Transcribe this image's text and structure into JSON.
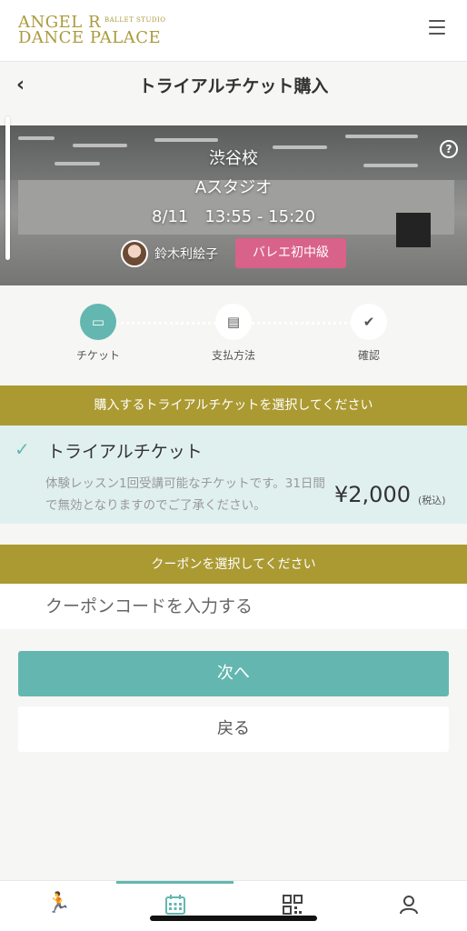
{
  "header": {
    "logo_line1": "ANGEL R",
    "logo_sub": "BALLET STUDIO",
    "logo_line2": "DANCE PALACE"
  },
  "titlebar": {
    "title": "トライアルチケット購入"
  },
  "hero": {
    "school": "渋谷校",
    "studio": "Aスタジオ",
    "time": "8/11　13:55 - 15:20",
    "teacher": "鈴木利絵子",
    "level": "バレエ初中級"
  },
  "steps": [
    {
      "label": "チケット",
      "icon": "ticket-icon",
      "active": true
    },
    {
      "label": "支払方法",
      "icon": "card-icon",
      "active": false
    },
    {
      "label": "確認",
      "icon": "check-icon",
      "active": false
    }
  ],
  "ticket_section": {
    "heading": "購入するトライアルチケットを選択してください"
  },
  "ticket": {
    "name": "トライアルチケット",
    "description": "体験レッスン1回受講可能なチケットです。31日間で無効となりますのでご了承ください。",
    "price": "¥2,000",
    "tax": "(税込)"
  },
  "coupon_section": {
    "heading": "クーポンを選択してください"
  },
  "coupon": {
    "placeholder": "クーポンコードを入力する"
  },
  "buttons": {
    "next": "次へ",
    "back": "戻る"
  },
  "tabs": [
    {
      "icon": "running-icon",
      "active": false
    },
    {
      "icon": "calendar-icon",
      "active": true
    },
    {
      "icon": "qr-code-icon",
      "active": false
    },
    {
      "icon": "user-icon",
      "active": false
    }
  ],
  "colors": {
    "accent": "#63b7b0",
    "gold": "#ab9a32",
    "badge": "#d9628a",
    "selected_bg": "#e0f0ef"
  }
}
